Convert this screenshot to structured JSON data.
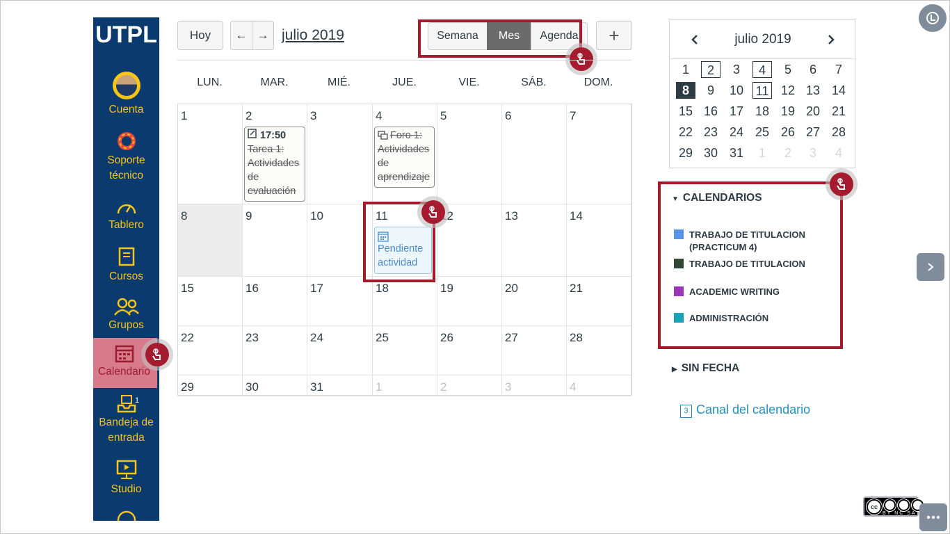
{
  "sidebar": {
    "logo": "UTPL",
    "items": [
      {
        "label": "Cuenta"
      },
      {
        "label": "Soporte técnico"
      },
      {
        "label": "Tablero"
      },
      {
        "label": "Cursos"
      },
      {
        "label": "Grupos"
      },
      {
        "label": "Calendario"
      },
      {
        "label": "Bandeja de entrada",
        "badge": "1"
      },
      {
        "label": "Studio"
      }
    ]
  },
  "toolbar": {
    "today_label": "Hoy",
    "prev_label": "←",
    "next_label": "→",
    "month_title": "julio 2019",
    "views": [
      "Semana",
      "Mes",
      "Agenda"
    ],
    "active_view": "Mes",
    "add_label": "+"
  },
  "calendar": {
    "weekdays": [
      "LUN.",
      "MAR.",
      "MIÉ.",
      "JUE.",
      "VIE.",
      "SÁB.",
      "DOM."
    ],
    "weeks": [
      [
        "1",
        "2",
        "3",
        "4",
        "5",
        "6",
        "7"
      ],
      [
        "8",
        "9",
        "10",
        "11",
        "12",
        "13",
        "14"
      ],
      [
        "15",
        "16",
        "17",
        "18",
        "19",
        "20",
        "21"
      ],
      [
        "22",
        "23",
        "24",
        "25",
        "26",
        "27",
        "28"
      ],
      [
        "29",
        "30",
        "31",
        "1",
        "2",
        "3",
        "4"
      ]
    ],
    "events": {
      "tarea": {
        "time": "17:50",
        "title": "Tarea 1: Actividades de evaluación"
      },
      "foro": {
        "title": "Foro 1: Actividades de aprendizaje"
      },
      "pendiente": {
        "title": "Pendiente actividad"
      }
    }
  },
  "mini_calendar": {
    "title": "julio 2019",
    "weeks": [
      [
        "1",
        "2",
        "3",
        "4",
        "5",
        "6",
        "7"
      ],
      [
        "8",
        "9",
        "10",
        "11",
        "12",
        "13",
        "14"
      ],
      [
        "15",
        "16",
        "17",
        "18",
        "19",
        "20",
        "21"
      ],
      [
        "22",
        "23",
        "24",
        "25",
        "26",
        "27",
        "28"
      ],
      [
        "29",
        "30",
        "31",
        "1",
        "2",
        "3",
        "4"
      ]
    ]
  },
  "calendars": {
    "title": "CALENDARIOS",
    "items": [
      {
        "label": "TRABAJO DE TITULACION (PRACTICUM 4)",
        "color": "#5b93e6"
      },
      {
        "label": "TRABAJO DE TITULACION",
        "color": "#2f4a33"
      },
      {
        "label": "ACADEMIC WRITING",
        "color": "#9b36b7"
      },
      {
        "label": "ADMINISTRACIÓN",
        "color": "#1aa2b5"
      }
    ]
  },
  "undated": {
    "title": "SIN FECHA"
  },
  "feed": {
    "label": "Canal del calendario",
    "icon_text": "3"
  },
  "license": {
    "top": "cc",
    "bottom": "BY NC SA"
  },
  "colors": {
    "sidebar_bg": "#0b3a6e",
    "sidebar_text": "#f5c518",
    "highlight": "#a21c2e",
    "link": "#2a8fb8"
  }
}
